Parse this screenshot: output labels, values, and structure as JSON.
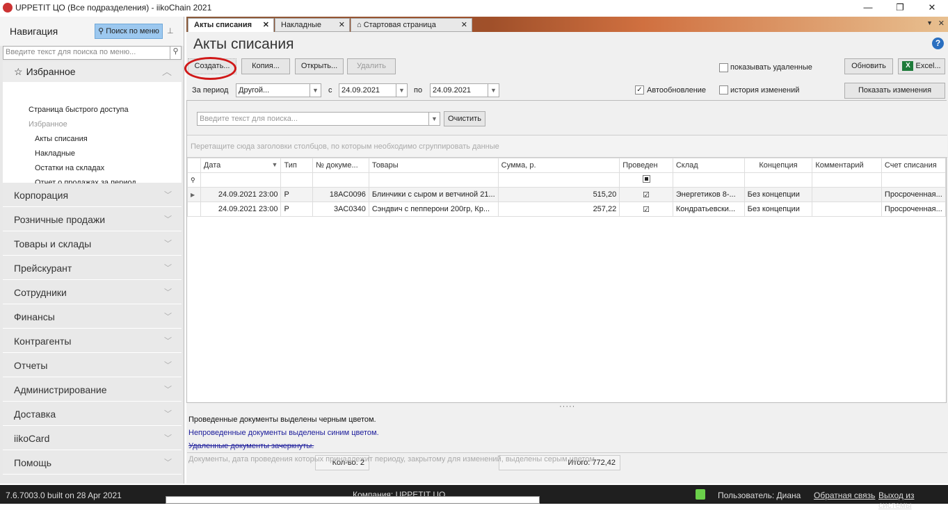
{
  "window": {
    "title": "UPPETIT ЦО (Все подразделения)  - iikoChain 2021",
    "minimize": "—",
    "maximize": "❐",
    "close": "✕"
  },
  "nav": {
    "title": "Навигация",
    "search_button": "Поиск по меню",
    "search_placeholder": "Введите текст для поиска по меню...",
    "favorites": {
      "label": "Избранное",
      "items": [
        "Страница быстрого доступа",
        "Избранное",
        "Акты списания",
        "Накладные",
        "Остатки на складах",
        "Отчет о продажах за период"
      ]
    },
    "sections": [
      "Корпорация",
      "Розничные продажи",
      "Товары и склады",
      "Прейскурант",
      "Сотрудники",
      "Финансы",
      "Контрагенты",
      "Отчеты",
      "Администрирование",
      "Доставка",
      "iikoCard",
      "Помощь"
    ]
  },
  "tabs": [
    {
      "label": "Акты списания"
    },
    {
      "label": "Накладные"
    },
    {
      "label": "Стартовая страница"
    }
  ],
  "page": {
    "title": "Акты списания",
    "toolbar": {
      "create": "Создать...",
      "copy": "Копия...",
      "open": "Открыть...",
      "delete": "Удалить",
      "show_deleted": "показывать удаленные",
      "refresh": "Обновить",
      "excel": "Excel..."
    },
    "filter": {
      "period_label": "За период",
      "period": "Другой...",
      "from_label": "с",
      "from": "24.09.2021",
      "to_label": "по",
      "to": "24.09.2021",
      "autorefresh": "Автообновление",
      "history": "история изменений",
      "show_changes": "Показать изменения"
    },
    "search_placeholder": "Введите текст для поиска...",
    "clear": "Очистить",
    "group_hint": "Перетащите сюда заголовки столбцов, по которым необходимо сгруппировать данные",
    "columns": [
      "Дата",
      "Тип",
      "№ докуме...",
      "Товары",
      "Сумма, р.",
      "Проведен",
      "Склад",
      "Концепция",
      "Комментарий",
      "Счет списания"
    ],
    "rows": [
      {
        "date": "24.09.2021 23:00",
        "type": "P",
        "num": "18AC0096",
        "goods": "Блинчики с сыром и ветчиной 21...",
        "sum": "515,20",
        "posted": true,
        "store": "Энергетиков 8-...",
        "concept": "Без концепции",
        "comment": "",
        "account": "Просроченная..."
      },
      {
        "date": "24.09.2021 23:00",
        "type": "P",
        "num": "3AC0340",
        "goods": "Сэндвич с пепперони 200гр, Кр...",
        "sum": "257,22",
        "posted": true,
        "store": "Кондратьевски...",
        "concept": "Без концепции",
        "comment": "",
        "account": "Просроченная..."
      }
    ],
    "count": "Кол-во: 2",
    "total": "Итого: 772,42",
    "legend": [
      "Проведенные документы выделены черным цветом.",
      "Непроведенные документы выделены синим цветом.",
      "Удаленные документы зачеркнуты.",
      "Документы, дата проведения которых принадлежит периоду, закрытому для изменений, выделены серым цветом."
    ]
  },
  "status": {
    "version": "7.6.7003.0 built on 28 Apr 2021",
    "company": "Компания: UPPETIT ЦО",
    "user": "Пользователь: Диана",
    "feedback": "Обратная связь",
    "logout": "Выход из системы"
  }
}
